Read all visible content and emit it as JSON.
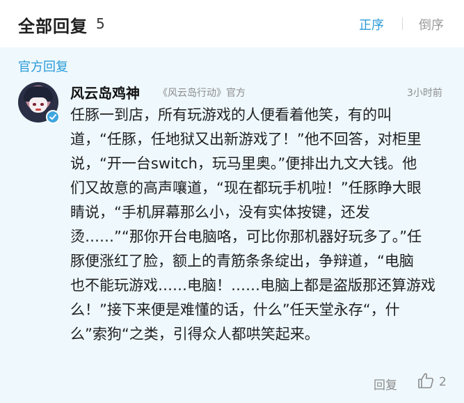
{
  "header": {
    "title": "全部回复",
    "count": "5",
    "sort_asc_label": "正序",
    "sort_desc_label": "倒序"
  },
  "section_label": "官方回复",
  "comment": {
    "username": "风云岛鸡神",
    "source": "《风云岛行动》官方",
    "timestamp": "3小时前",
    "lines": [
      "任豚一到店，所有玩游戏的人便看着他笑，有的叫",
      "道，“任豚，任地狱又出新游戏了！”他不回答，对柜里",
      "说，“开一台switch，玩马里奥。”便排出九文大钱。他",
      "们又故意的高声嚷道，“现在都玩手机啦！”任豚睁大眼",
      "睛说，“手机屏幕那么小，没有实体按键，还发",
      "烫……”“那你开台电脑咯，可比你那机器好玩多了。”任",
      "豚便涨红了脸，额上的青筋条条绽出，争辩道，“电脑",
      "也不能玩游戏……电脑！……电脑上都是盗版那还算游戏",
      "么！”接下来便是难懂的话，什么”任天堂永存“，什",
      "么”索狗“之类，引得众人都哄笑起来。"
    ],
    "reply_label": "回复",
    "like_count": "2",
    "avatar_icon": "avatar-image",
    "verified_icon": "verified-badge-icon",
    "like_icon": "thumbs-up-icon"
  },
  "colors": {
    "accent": "#2a9bd8",
    "band_background": "#eef8fd",
    "muted_text": "#8c8c8c"
  }
}
